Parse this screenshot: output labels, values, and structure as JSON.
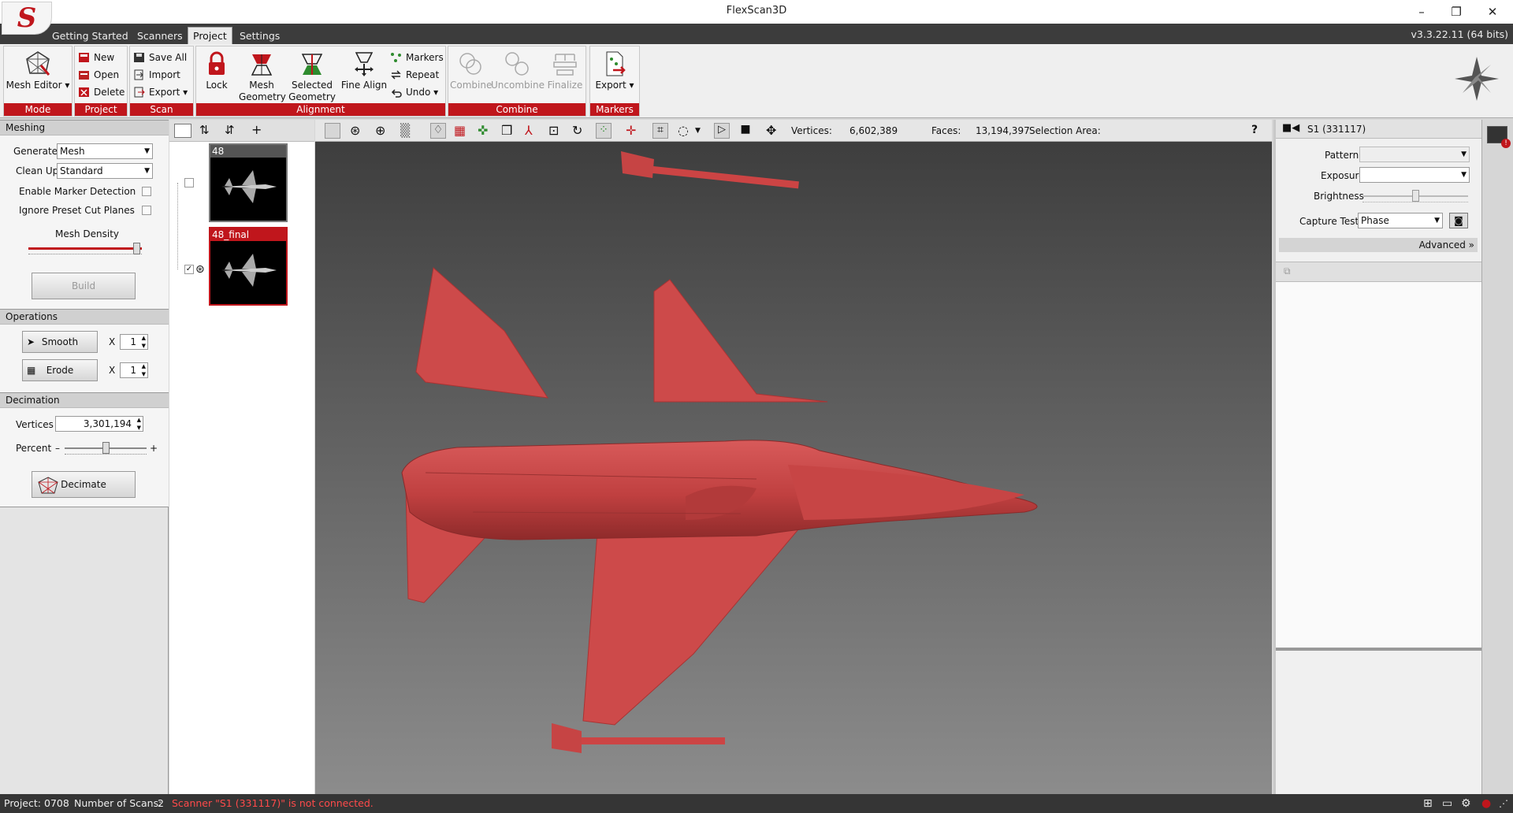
{
  "window": {
    "title": "FlexScan3D",
    "minimize": "–",
    "restore": "❐",
    "close": "✕"
  },
  "tabs": [
    "Getting Started",
    "Scanners",
    "Project",
    "Settings"
  ],
  "version": "v3.3.22.11  (64 bits)",
  "ribbon": {
    "mode": {
      "label": "Mode",
      "mesh_editor": "Mesh Editor ▾"
    },
    "project": {
      "label": "Project",
      "new": "New",
      "open": "Open",
      "delete": "Delete"
    },
    "scan": {
      "label": "Scan",
      "save_all": "Save All",
      "import": "Import",
      "export": "Export ▾"
    },
    "alignment": {
      "label": "Alignment",
      "lock": "Lock",
      "mesh_geometry_1": "Mesh",
      "mesh_geometry_2": "Geometry",
      "selected_geometry_1": "Selected",
      "selected_geometry_2": "Geometry",
      "fine_align": "Fine Align",
      "markers": "Markers",
      "repeat": "Repeat",
      "undo": "Undo ▾"
    },
    "combine": {
      "label": "Combine",
      "combine": "Combine",
      "uncombine": "Uncombine",
      "finalize": "Finalize"
    },
    "markers": {
      "label": "Markers",
      "export": "Export ▾"
    }
  },
  "meshing": {
    "header": "Meshing",
    "generate_label": "Generate",
    "generate_value": "Mesh",
    "cleanup_label": "Clean Up",
    "cleanup_value": "Standard",
    "marker_detection": "Enable Marker Detection",
    "ignore_cut_planes": "Ignore Preset Cut Planes",
    "mesh_density": "Mesh Density",
    "mesh_density_level": 0.95,
    "build": "Build"
  },
  "operations": {
    "header": "Operations",
    "smooth": "Smooth",
    "smooth_x": "X",
    "smooth_count": "1",
    "erode": "Erode",
    "erode_x": "X",
    "erode_count": "1"
  },
  "decimation": {
    "header": "Decimation",
    "vertices_label": "Vertices",
    "vertices_value": "3,301,194",
    "percent_label": "Percent",
    "minus": "–",
    "plus": "+",
    "percent_level": 0.5,
    "decimate": "Decimate"
  },
  "tree": {
    "items": [
      {
        "label": "48",
        "selected": false
      },
      {
        "label": "48_final",
        "selected": true
      }
    ],
    "add": "+"
  },
  "viewport": {
    "vertices_label": "Vertices:",
    "vertices_value": "6,602,389",
    "faces_label": "Faces:",
    "faces_value": "13,194,397",
    "selection_label": "Selection Area:",
    "help": "?",
    "model_color": "#cc4a4a"
  },
  "scanner": {
    "name": "S1 (331117)",
    "pattern_label": "Pattern",
    "exposure_label": "Exposure",
    "brightness_label": "Brightness",
    "brightness_level": 0.5,
    "capture_test_label": "Capture Test",
    "capture_test_value": "Phase",
    "advanced": "Advanced »"
  },
  "status": {
    "project_label": "Project:",
    "project_value": "0708",
    "scans_label": "Number of Scans:",
    "scans_value": "2",
    "message": "Scanner \"S1 (331117)\" is not connected.",
    "message_color": "#ff4a4a"
  },
  "colors": {
    "accent": "#c0161c",
    "dark": "#3c3c3c"
  }
}
